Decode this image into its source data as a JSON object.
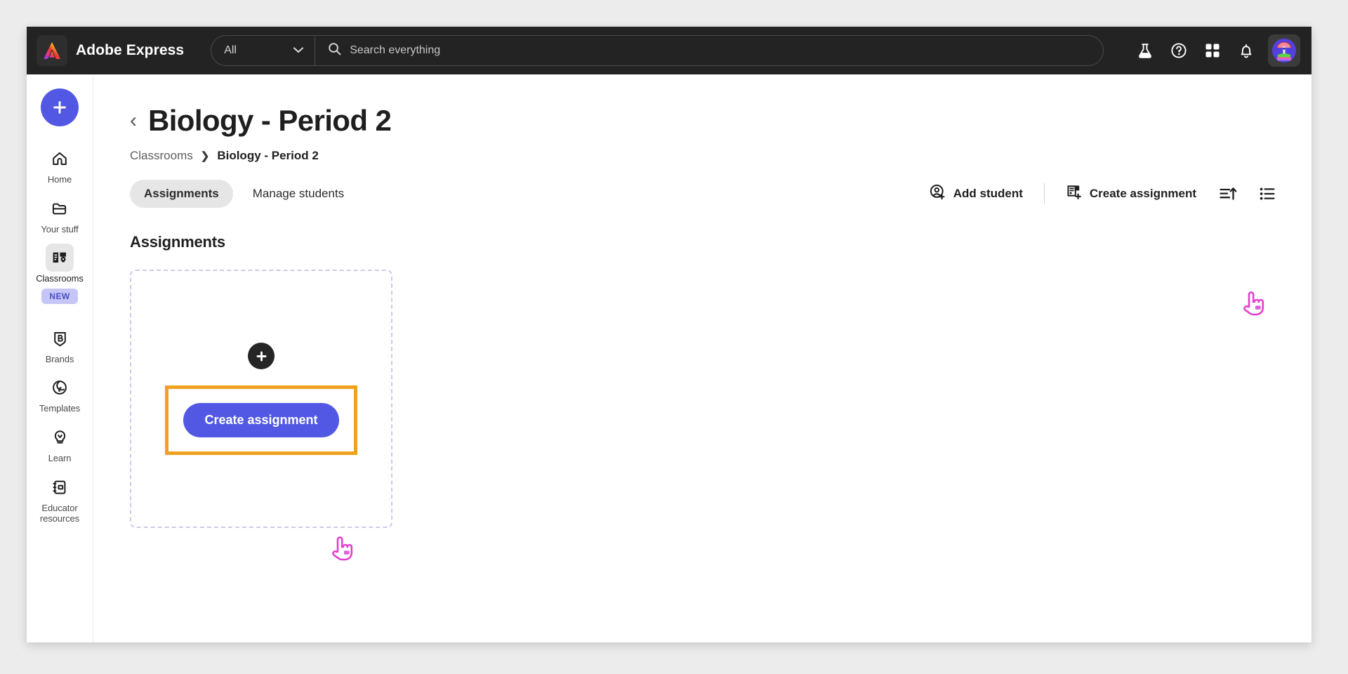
{
  "header": {
    "logo_icon": "adobe-express-logo-icon",
    "brand": "Adobe Express",
    "scope_selected": "All",
    "scope_caret_icon": "chevron-down-icon",
    "search_icon": "search-icon",
    "search_placeholder": "Search everything",
    "search_value": "",
    "actions": [
      {
        "icon": "flask-icon",
        "label": "Beta features"
      },
      {
        "icon": "help-circle-icon",
        "label": "Help"
      },
      {
        "icon": "apps-grid-icon",
        "label": "Apps"
      },
      {
        "icon": "bell-icon",
        "label": "Notifications"
      }
    ],
    "avatar_icon": "user-avatar"
  },
  "sidebar": {
    "create_button_icon": "plus-icon",
    "items": [
      {
        "label": "Home",
        "icon": "home-icon",
        "active": false,
        "badge": ""
      },
      {
        "label": "Your stuff",
        "icon": "folder-icon",
        "active": false,
        "badge": ""
      },
      {
        "label": "Classrooms",
        "icon": "classroom-icon",
        "active": true,
        "badge": "NEW"
      },
      {
        "label": "Brands",
        "icon": "brand-shield-icon",
        "active": false,
        "badge": ""
      },
      {
        "label": "Templates",
        "icon": "templates-icon",
        "active": false,
        "badge": ""
      },
      {
        "label": "Learn",
        "icon": "lightbulb-icon",
        "active": false,
        "badge": ""
      },
      {
        "label": "Educator resources",
        "icon": "notebook-icon",
        "active": false,
        "badge": ""
      }
    ]
  },
  "main": {
    "back_chevron_icon": "chevron-left-icon",
    "page_title": "Biology - Period 2",
    "breadcrumb": {
      "root": "Classrooms",
      "separator": "›",
      "current": "Biology - Period 2"
    },
    "tabs": [
      {
        "label": "Assignments",
        "active": true
      },
      {
        "label": "Manage students",
        "active": false
      }
    ],
    "toolbar": {
      "add_student_icon": "add-user-icon",
      "add_student_label": "Add student",
      "create_assignment_icon": "add-document-icon",
      "create_assignment_label": "Create assignment",
      "sort_icon": "sort-ascending-icon",
      "view_icon": "list-view-icon"
    },
    "section_heading": "Assignments",
    "empty_card": {
      "plus_icon": "plus-icon",
      "cta_label": "Create assignment"
    },
    "cursors": [
      {
        "name": "cursor-toolbar",
        "icon": "pointing-hand-cursor"
      },
      {
        "name": "cursor-cta",
        "icon": "pointing-hand-cursor"
      }
    ],
    "highlight_color": "#efa220",
    "accent_color": "#5258e4"
  }
}
